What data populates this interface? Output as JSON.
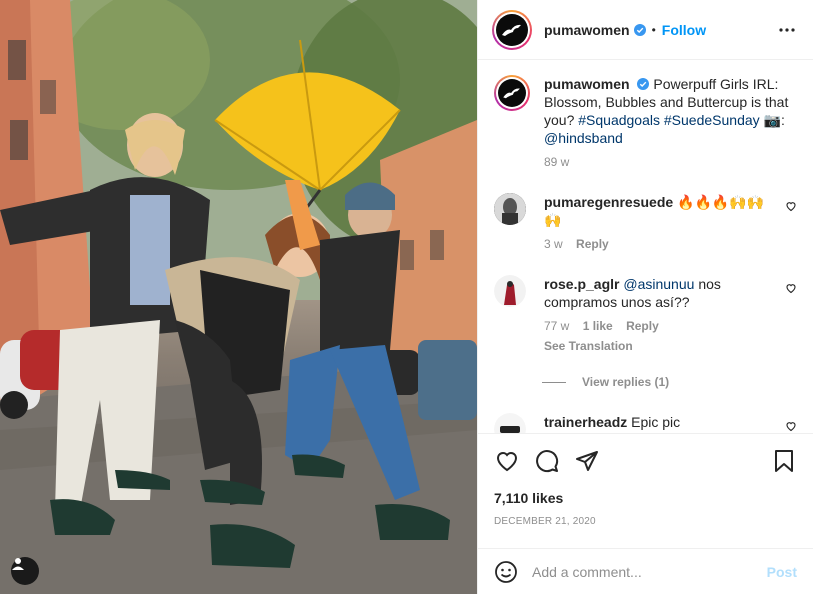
{
  "header": {
    "username": "pumawomen",
    "dot": "•",
    "follow_label": "Follow"
  },
  "caption": {
    "username": "pumawomen",
    "text": "Powerpuff Girls IRL: Blossom, Bubbles and Buttercup is that you?",
    "hashtag1": "#Squadgoals",
    "hashtag2": "#SuedeSunday",
    "camera": "📷:",
    "mention": "@hindsband",
    "age": "89 w"
  },
  "comments": [
    {
      "username": "pumaregenresuede",
      "text": "🔥🔥🔥🙌🙌 🙌",
      "age": "3 w",
      "reply_label": "Reply"
    },
    {
      "username": "rose.p_aglr",
      "mention": "@asinunuu",
      "text": "nos compramos unos así??",
      "age": "77 w",
      "likes_label": "1 like",
      "reply_label": "Reply",
      "see_translation": "See Translation",
      "view_replies": "View replies (1)"
    },
    {
      "username": "trainerheadz",
      "text": "Epic pic"
    }
  ],
  "post": {
    "likes": "7,110 likes",
    "date": "DECEMBER 21, 2020"
  },
  "add_comment": {
    "placeholder": "Add a comment...",
    "post_label": "Post"
  },
  "colors": {
    "accent": "#0095f6",
    "umbrella": "#f5c21b",
    "link": "#00376b",
    "muted": "#8e8e8e"
  }
}
